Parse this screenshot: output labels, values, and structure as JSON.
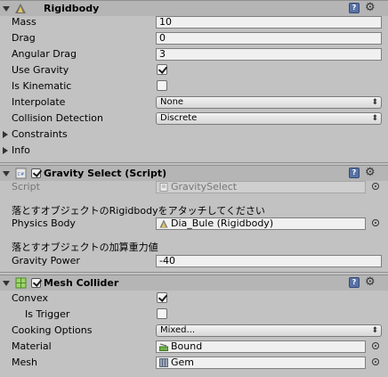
{
  "rigidbody": {
    "title": "Rigidbody",
    "fields": {
      "mass": {
        "label": "Mass",
        "value": "10"
      },
      "drag": {
        "label": "Drag",
        "value": "0"
      },
      "angular_drag": {
        "label": "Angular Drag",
        "value": "3"
      },
      "use_gravity": {
        "label": "Use Gravity",
        "checked": true
      },
      "is_kinematic": {
        "label": "Is Kinematic",
        "checked": false
      },
      "interpolate": {
        "label": "Interpolate",
        "value": "None"
      },
      "collision_detection": {
        "label": "Collision Detection",
        "value": "Discrete"
      }
    },
    "constraints_label": "Constraints",
    "info_label": "Info"
  },
  "gravity_select": {
    "title": "Gravity Select (Script)",
    "script": {
      "label": "Script",
      "value": "GravitySelect"
    },
    "header1": "落とすオブジェクトのRigidbodyをアタッチしてください",
    "physics_body": {
      "label": "Physics Body",
      "value": "Dia_Bule (Rigidbody)"
    },
    "header2": "落とすオブジェクトの加算重力値",
    "gravity_power": {
      "label": "Gravity Power",
      "value": "-40"
    }
  },
  "mesh_collider": {
    "title": "Mesh Collider",
    "convex": {
      "label": "Convex",
      "checked": true
    },
    "is_trigger": {
      "label": "Is Trigger",
      "checked": false
    },
    "cooking_options": {
      "label": "Cooking Options",
      "value": "Mixed..."
    },
    "material": {
      "label": "Material",
      "value": "Bound"
    },
    "mesh": {
      "label": "Mesh",
      "value": "Gem"
    }
  },
  "icons": {
    "help": "book-icon",
    "settings": "gear-icon"
  },
  "colors": {
    "panel_bg": "#c2c2c2",
    "header_bg": "#b5b5b5",
    "field_bg": "#f0f0f0"
  }
}
